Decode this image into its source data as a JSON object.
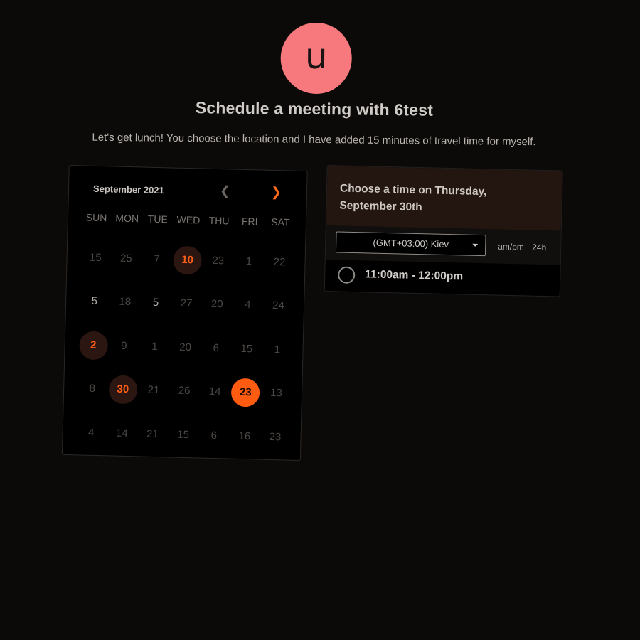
{
  "header": {
    "avatar_initial": "u",
    "title": "Schedule a meeting with 6test",
    "subtitle": "Let's get lunch! You choose the location and I have added 15 minutes of travel time for myself."
  },
  "calendar": {
    "month_label": "September 2021",
    "prev_icon": "chevron-left-icon",
    "next_icon": "chevron-right-icon",
    "weekdays": [
      "SUN",
      "MON",
      "TUE",
      "WED",
      "THU",
      "FRI",
      "SAT"
    ],
    "days": [
      {
        "label": "15",
        "state": "disabled"
      },
      {
        "label": "25",
        "state": "disabled"
      },
      {
        "label": "7",
        "state": "disabled"
      },
      {
        "label": "10",
        "state": "available"
      },
      {
        "label": "23",
        "state": "disabled"
      },
      {
        "label": "1",
        "state": "disabled"
      },
      {
        "label": "22",
        "state": "disabled"
      },
      {
        "label": "5",
        "state": "enabled"
      },
      {
        "label": "18",
        "state": "disabled"
      },
      {
        "label": "5",
        "state": "enabled"
      },
      {
        "label": "27",
        "state": "disabled"
      },
      {
        "label": "20",
        "state": "disabled"
      },
      {
        "label": "4",
        "state": "disabled"
      },
      {
        "label": "24",
        "state": "disabled"
      },
      {
        "label": "2",
        "state": "available"
      },
      {
        "label": "9",
        "state": "disabled"
      },
      {
        "label": "1",
        "state": "disabled"
      },
      {
        "label": "20",
        "state": "disabled"
      },
      {
        "label": "6",
        "state": "disabled"
      },
      {
        "label": "15",
        "state": "disabled"
      },
      {
        "label": "1",
        "state": "disabled"
      },
      {
        "label": "8",
        "state": "disabled"
      },
      {
        "label": "30",
        "state": "available"
      },
      {
        "label": "21",
        "state": "disabled"
      },
      {
        "label": "26",
        "state": "disabled"
      },
      {
        "label": "14",
        "state": "disabled"
      },
      {
        "label": "23",
        "state": "selected"
      },
      {
        "label": "13",
        "state": "disabled"
      },
      {
        "label": "4",
        "state": "disabled"
      },
      {
        "label": "14",
        "state": "disabled"
      },
      {
        "label": "21",
        "state": "disabled"
      },
      {
        "label": "15",
        "state": "disabled"
      },
      {
        "label": "6",
        "state": "disabled"
      },
      {
        "label": "16",
        "state": "disabled"
      },
      {
        "label": "23",
        "state": "disabled"
      }
    ]
  },
  "times": {
    "title": "Choose a time on Thursday, September 30th",
    "timezone": "(GMT+03:00) Kiev",
    "format_ampm": "am/pm",
    "format_24h": "24h",
    "slots": [
      {
        "label": "11:00am - 12:00pm"
      }
    ]
  },
  "colors": {
    "background": "#0c0a08",
    "accent": "#ff5c12",
    "avatar": "#f7797d",
    "available_bg": "#2b1611",
    "panel_header": "#231510"
  }
}
